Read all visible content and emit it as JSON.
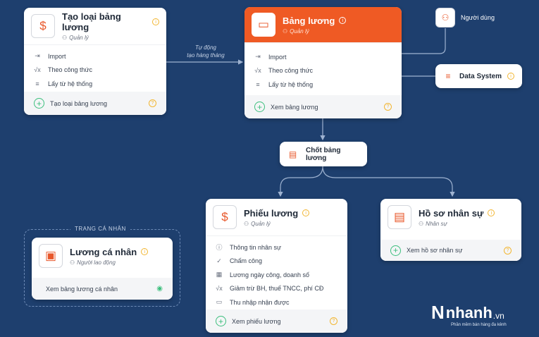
{
  "connector": {
    "auto_label_1": "Tự động",
    "auto_label_2": "tạo hàng tháng"
  },
  "create_type": {
    "title": "Tạo loại bảng lương",
    "role": "Quản lý",
    "items": [
      {
        "label": "Import",
        "icon": "import-icon"
      },
      {
        "label": "Theo công thức",
        "icon": "formula-icon"
      },
      {
        "label": "Lấy từ hệ thống",
        "icon": "database-icon"
      }
    ],
    "footer": "Tạo loại bảng lương"
  },
  "payroll": {
    "title": "Bảng lương",
    "role": "Quản lý",
    "items": [
      {
        "label": "Import",
        "icon": "import-icon"
      },
      {
        "label": "Theo công thức",
        "icon": "formula-icon"
      },
      {
        "label": "Lấy từ hệ thống",
        "icon": "database-icon"
      }
    ],
    "footer": "Xem bảng lương"
  },
  "user": {
    "label": "Người dùng"
  },
  "data_system": {
    "label": "Data System"
  },
  "finalize": {
    "label": "Chốt bảng lương"
  },
  "payslip": {
    "title": "Phiếu lương",
    "role": "Quản lý",
    "items": [
      {
        "label": "Thông tin nhân sự",
        "icon": "info-icon"
      },
      {
        "label": "Chấm công",
        "icon": "check-icon"
      },
      {
        "label": "Lương ngày công, doanh số",
        "icon": "calendar-icon"
      },
      {
        "label": "Giảm trừ BH, thuế TNCC, phí CĐ",
        "icon": "formula-icon"
      },
      {
        "label": "Thu nhập nhận được",
        "icon": "wallet-icon"
      }
    ],
    "footer": "Xem phiếu lương"
  },
  "hr_profile": {
    "title": "Hồ sơ nhân sự",
    "role": "Nhân sự",
    "footer": "Xem hồ sơ nhân sự"
  },
  "personal_page": {
    "label": "TRANG CÁ NHÂN"
  },
  "personal_salary": {
    "title": "Lương cá nhân",
    "role": "Người lao động",
    "footer": "Xem bảng lương cá nhân"
  },
  "brand": {
    "name": "nhanh",
    "tld": ".vn",
    "slogan": "Phần mềm bán hàng đa kênh"
  },
  "colors": {
    "background": "#1e3f6e",
    "accent": "#ef5a24",
    "green": "#3cbf7d",
    "info": "#f2b632"
  }
}
